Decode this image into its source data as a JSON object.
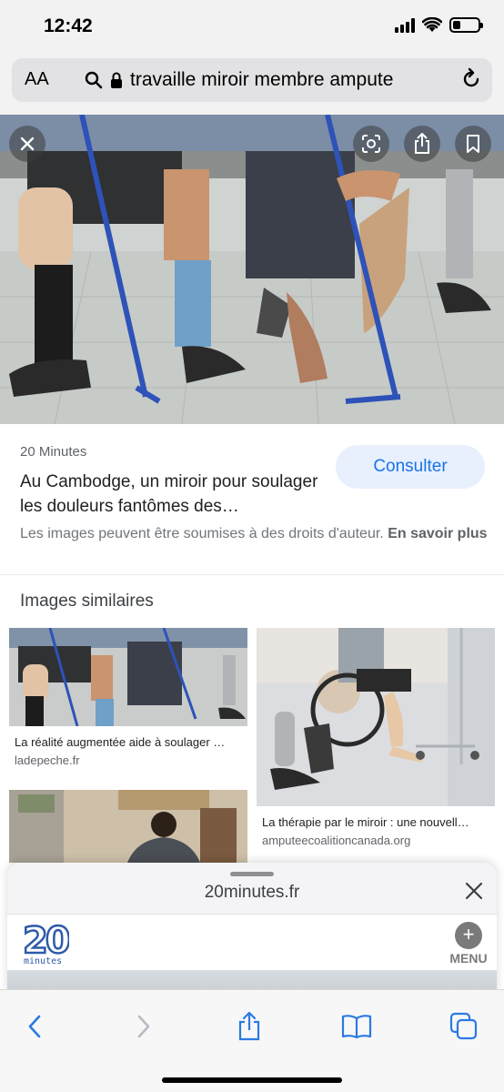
{
  "status_bar": {
    "time": "12:42",
    "battery_level": 0.3
  },
  "address_bar": {
    "aa_label": "AA",
    "url": "travaille miroir membre ampute"
  },
  "hero": {
    "close_icon": "close-icon",
    "lens_icon": "lens-icon",
    "share_icon": "share-icon",
    "bookmark_icon": "bookmark-icon"
  },
  "result": {
    "source": "20 Minutes",
    "title": "Au Cambodge, un miroir pour soulager les douleurs fantômes des…",
    "consult_label": "Consulter",
    "copyright_text": "Les images peuvent être soumises à des droits d'auteur.",
    "learn_more": "En savoir plus"
  },
  "similar": {
    "heading": "Images similaires",
    "items": [
      {
        "caption": "La réalité augmentée aide à soulager …",
        "domain": "ladepeche.fr"
      },
      {
        "caption": "La thérapie par le miroir : une nouvell…",
        "domain": "amputeecoalitioncanada.org"
      },
      {
        "caption": "",
        "domain": ""
      }
    ]
  },
  "sheet": {
    "domain": "20minutes.fr",
    "logo_number": "20",
    "logo_word": "minutes",
    "menu_label": "MENU",
    "menu_plus": "+"
  },
  "colors": {
    "accent": "#1a73e8",
    "consult_bg": "#e8f0fe",
    "toolbar_icon": "#2a7ae2"
  }
}
